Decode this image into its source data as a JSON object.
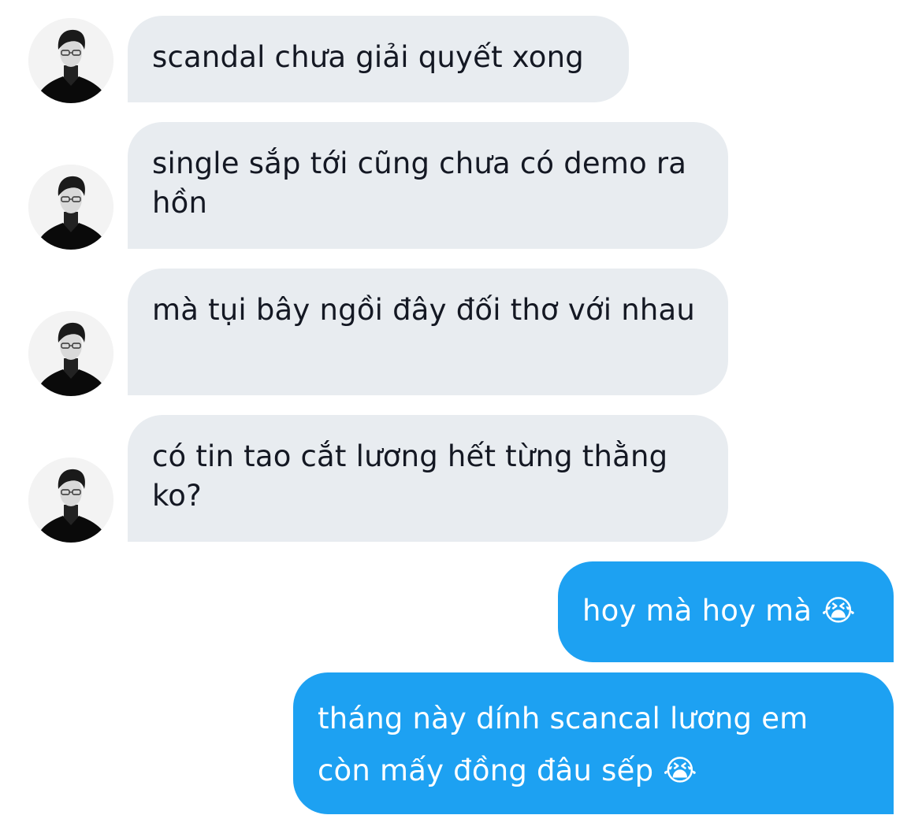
{
  "messages": [
    {
      "side": "in",
      "text": "scandal chưa giải quyết xong"
    },
    {
      "side": "in",
      "text": "single sắp tới cũng chưa có demo ra hồn"
    },
    {
      "side": "in",
      "text": "mà tụi bây ngồi đây đối thơ với nhau"
    },
    {
      "side": "in",
      "text": "có tin tao cắt lương hết từng thằng ko?"
    },
    {
      "side": "out",
      "text": "hoy mà hoy mà 😭"
    },
    {
      "side": "out",
      "text": "tháng này dính scancal lương em còn mấy đồng đâu sếp 😭"
    }
  ],
  "colors": {
    "incoming_bubble": "#e8ecf0",
    "incoming_text": "#141823",
    "outgoing_bubble": "#1da1f2",
    "outgoing_text": "#ffffff"
  },
  "icons": {
    "avatar": "sender-avatar-icon",
    "emoji": "loudly-crying-face-emoji"
  }
}
